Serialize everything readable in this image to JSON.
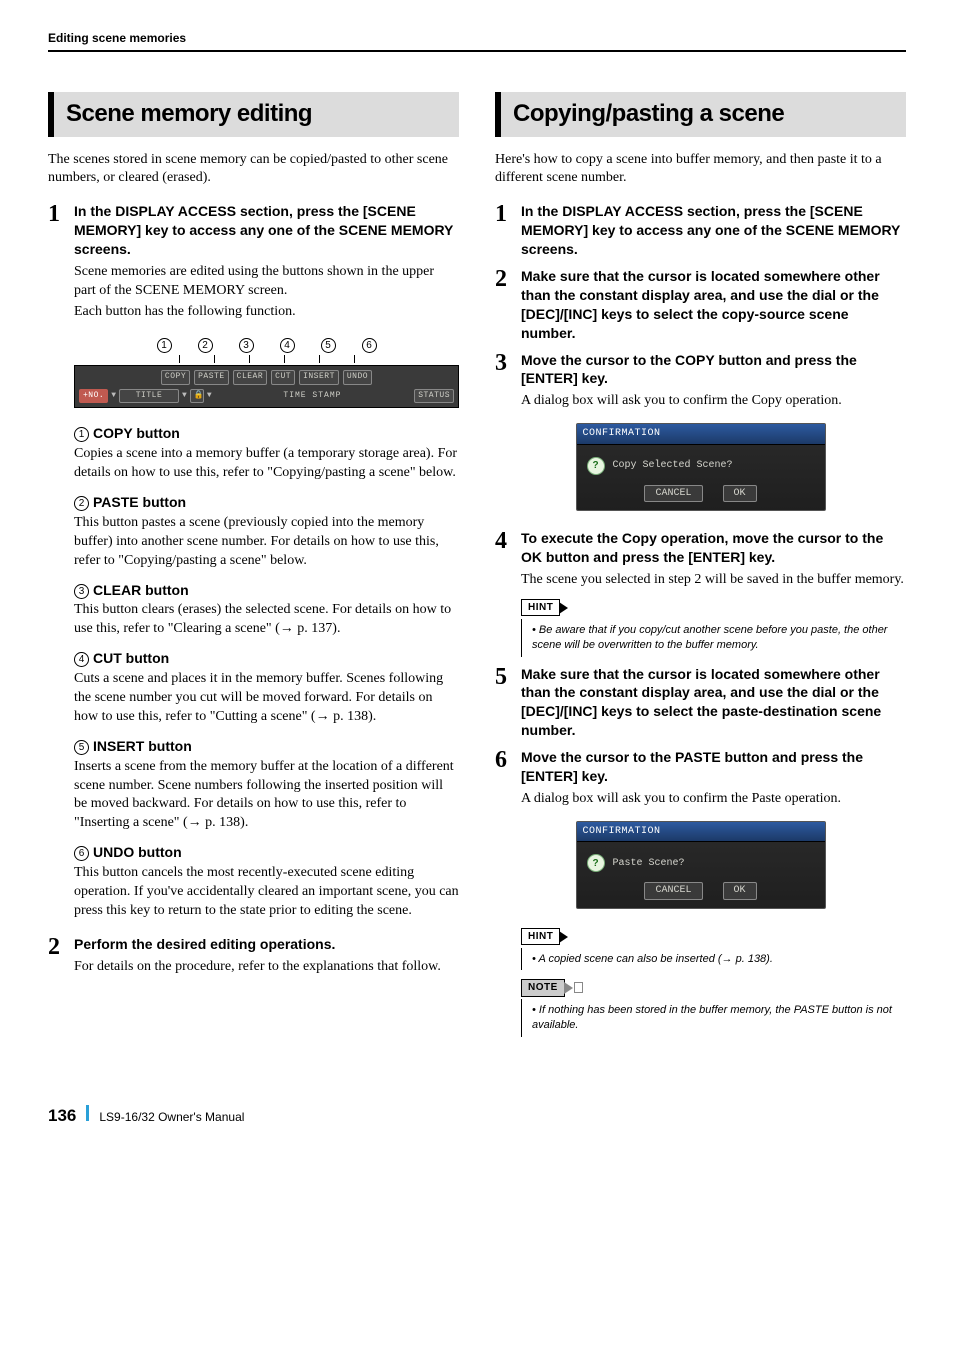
{
  "header": {
    "title": "Editing scene memories"
  },
  "left": {
    "title": "Scene memory editing",
    "intro": "The scenes stored in scene memory can be copied/pasted to other scene numbers, or cleared (erased).",
    "step1": {
      "num": "1",
      "head": "In the DISPLAY ACCESS section, press the [SCENE MEMORY] key to access any one of the SCENE MEMORY screens.",
      "desc1": "Scene memories are edited using the buttons shown in the upper part of the SCENE MEMORY screen.",
      "desc2": "Each button has the following function."
    },
    "ui": {
      "callouts": [
        "1",
        "2",
        "3",
        "4",
        "5",
        "6"
      ],
      "row1": [
        "COPY",
        "PASTE",
        "CLEAR",
        "CUT",
        "INSERT",
        "UNDO"
      ],
      "no_tag": "+NO.",
      "title_cell": "TITLE",
      "lock_cell": "🔒",
      "timestamp": "TIME STAMP",
      "status": "STATUS"
    },
    "buttons": [
      {
        "n": "1",
        "name": "COPY button",
        "desc": "Copies a scene into a memory buffer (a temporary storage area). For details on how to use this, refer to \"Copying/pasting a scene\" below."
      },
      {
        "n": "2",
        "name": "PASTE button",
        "desc": "This button pastes a scene (previously copied into the memory buffer) into another scene number. For details on how to use this, refer to \"Copying/pasting a scene\" below."
      },
      {
        "n": "3",
        "name": "CLEAR button",
        "desc": "This button clears (erases) the selected scene. For details on how to use this, refer to \"Clearing a scene\" (→ p. 137)."
      },
      {
        "n": "4",
        "name": "CUT button",
        "desc": "Cuts a scene and places it in the memory buffer. Scenes following the scene number you cut will be moved forward. For details on how to use this, refer to \"Cutting a scene\" (→ p. 138)."
      },
      {
        "n": "5",
        "name": "INSERT button",
        "desc": "Inserts a scene from the memory buffer at the location of a different scene number. Scene numbers following the inserted position will be moved backward. For details on how to use this, refer to \"Inserting a scene\" (→ p. 138)."
      },
      {
        "n": "6",
        "name": "UNDO button",
        "desc": "This button cancels the most recently-executed scene editing operation. If you've accidentally cleared an important scene, you can press this key to return to the state prior to editing the scene."
      }
    ],
    "step2": {
      "num": "2",
      "head": "Perform the desired editing operations.",
      "desc": "For details on the procedure, refer to the explanations that follow."
    }
  },
  "right": {
    "title": "Copying/pasting a scene",
    "intro": "Here's how to copy a scene into buffer memory, and then paste it to a different scene number.",
    "steps": {
      "s1": {
        "num": "1",
        "head": "In the DISPLAY ACCESS section, press the [SCENE MEMORY] key to access any one of the SCENE MEMORY screens."
      },
      "s2": {
        "num": "2",
        "head": "Make sure that the cursor is located somewhere other than the constant display area, and use the dial or the [DEC]/[INC] keys to select the copy-source scene number."
      },
      "s3": {
        "num": "3",
        "head": "Move the cursor to the COPY button and press the [ENTER] key.",
        "desc": "A dialog box will ask you to confirm the Copy operation."
      },
      "s4": {
        "num": "4",
        "head": "To execute the Copy operation, move the cursor to the OK button and press the [ENTER] key.",
        "desc": "The scene you selected in step 2 will be saved in the buffer memory."
      },
      "s5": {
        "num": "5",
        "head": "Make sure that the cursor is located somewhere other than the constant display area, and use the dial or the [DEC]/[INC] keys to select the paste-destination scene number."
      },
      "s6": {
        "num": "6",
        "head": "Move the cursor to the PASTE button and press the [ENTER] key.",
        "desc": "A dialog box will ask you to confirm the Paste operation."
      }
    },
    "dialog_copy": {
      "title": "CONFIRMATION",
      "msg": "Copy Selected Scene?",
      "cancel": "CANCEL",
      "ok": "OK"
    },
    "dialog_paste": {
      "title": "CONFIRMATION",
      "msg": "Paste Scene?",
      "cancel": "CANCEL",
      "ok": "OK"
    },
    "hint1": {
      "tag": "HINT",
      "text": "Be aware that if you copy/cut another scene before you paste, the other scene will be overwritten to the buffer memory."
    },
    "hint2": {
      "tag": "HINT",
      "text": "A copied scene can also be inserted (→ p. 138)."
    },
    "note": {
      "tag": "NOTE",
      "text": "If nothing has been stored in the buffer memory, the PASTE button is not available."
    }
  },
  "footer": {
    "page": "136",
    "manual": "LS9-16/32  Owner's Manual"
  }
}
